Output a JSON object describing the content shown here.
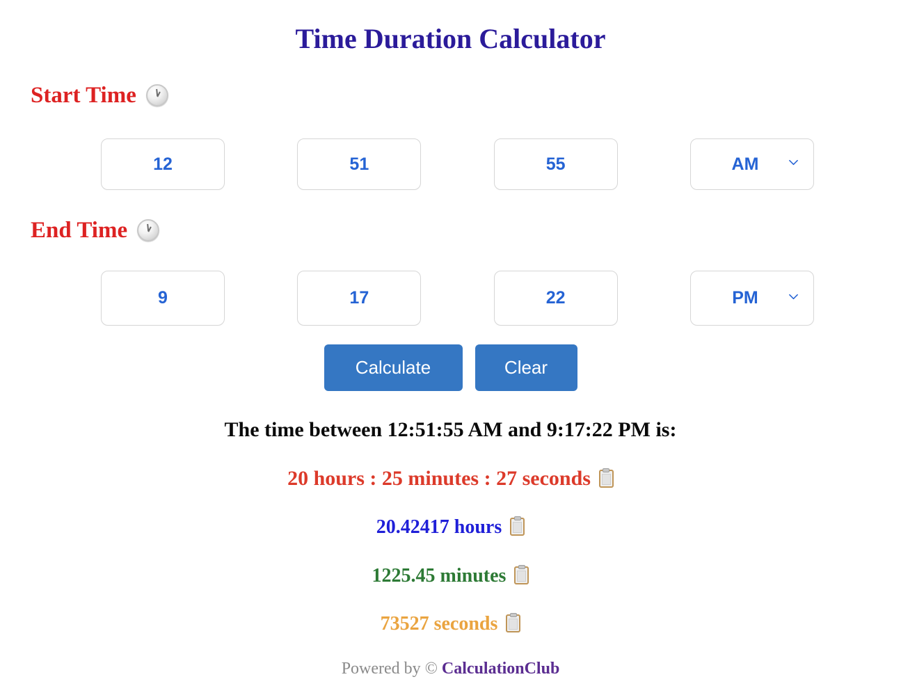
{
  "page": {
    "title": "Time Duration Calculator",
    "background_color": "#ffffff",
    "title_color": "#2b1b9a"
  },
  "start_time": {
    "label": "Start Time",
    "icon": "clock-icon",
    "hour": "12",
    "minute": "51",
    "second": "55",
    "meridiem": "AM",
    "meridiem_options": [
      "AM",
      "PM"
    ],
    "value_color": "#2563d4",
    "label_color": "#dd2222"
  },
  "end_time": {
    "label": "End Time",
    "icon": "clock-icon",
    "hour": "9",
    "minute": "17",
    "second": "22",
    "meridiem": "PM",
    "meridiem_options": [
      "AM",
      "PM"
    ],
    "value_color": "#2563d4",
    "label_color": "#dd2222"
  },
  "actions": {
    "calculate_label": "Calculate",
    "clear_label": "Clear",
    "button_color": "#3577c3"
  },
  "results": {
    "heading": "The time between 12:51:55 AM and 9:17:22 PM is:",
    "hms": "20 hours : 25 minutes : 27 seconds",
    "hms_color": "#dc3a2a",
    "hours": "20.42417 hours",
    "hours_color": "#1f1fd8",
    "minutes": "1225.45 minutes",
    "minutes_color": "#2d7a35",
    "seconds": "73527 seconds",
    "seconds_color": "#eaa440",
    "copy_icon": "clipboard-icon"
  },
  "footer": {
    "powered_by": "Powered by",
    "copyright_symbol": "©",
    "brand": "CalculationClub",
    "text_color": "#8a8a8a",
    "brand_color": "#5b2d91"
  }
}
